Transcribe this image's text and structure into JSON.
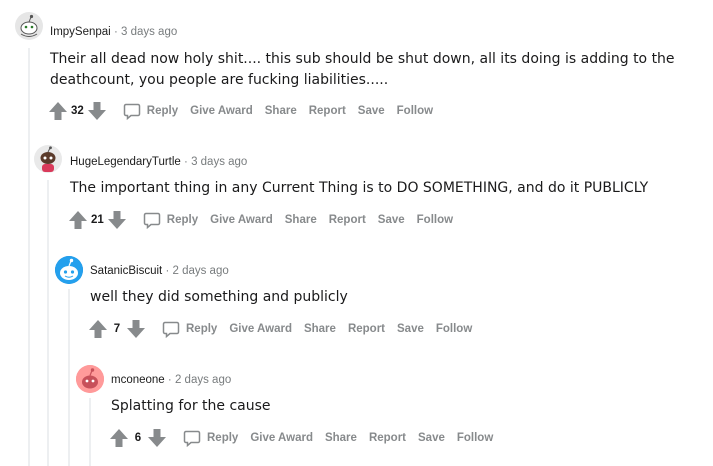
{
  "comments": [
    {
      "username": "ImpySenpai",
      "separator": "·",
      "time": "3 days ago",
      "text_lines": [
        "Their all dead now holy shit.... this sub should be shut down, all its doing is adding to the",
        "deathcount, you people are fucking liabilities....."
      ],
      "votes": "32",
      "avatar_icon": "snoo-avatar-icon"
    },
    {
      "username": "HugeLegendaryTurtle",
      "separator": "·",
      "time": "3 days ago",
      "text_lines": [
        "The important thing in any Current Thing is to DO SOMETHING, and do it PUBLICLY"
      ],
      "votes": "21",
      "avatar_icon": "snoo-avatar-icon"
    },
    {
      "username": "SatanicBiscuit",
      "separator": "·",
      "time": "2 days ago",
      "text_lines": [
        "well they did something and publicly"
      ],
      "votes": "7",
      "avatar_icon": "snoo-avatar-icon"
    },
    {
      "username": "mconeone",
      "separator": "·",
      "time": "2 days ago",
      "text_lines": [
        "Splatting for the cause"
      ],
      "votes": "6",
      "avatar_icon": "snoo-avatar-icon"
    }
  ],
  "actions": {
    "reply": "Reply",
    "give_award": "Give Award",
    "share": "Share",
    "report": "Report",
    "save": "Save",
    "follow": "Follow"
  },
  "colors": {
    "upvote_arrow": "#878a8c",
    "action_text": "#878a8c",
    "thread_line": "#edeff1",
    "avatar_blue_bg": "#0079d3",
    "avatar_pink_bg": "#ff8b8b"
  }
}
